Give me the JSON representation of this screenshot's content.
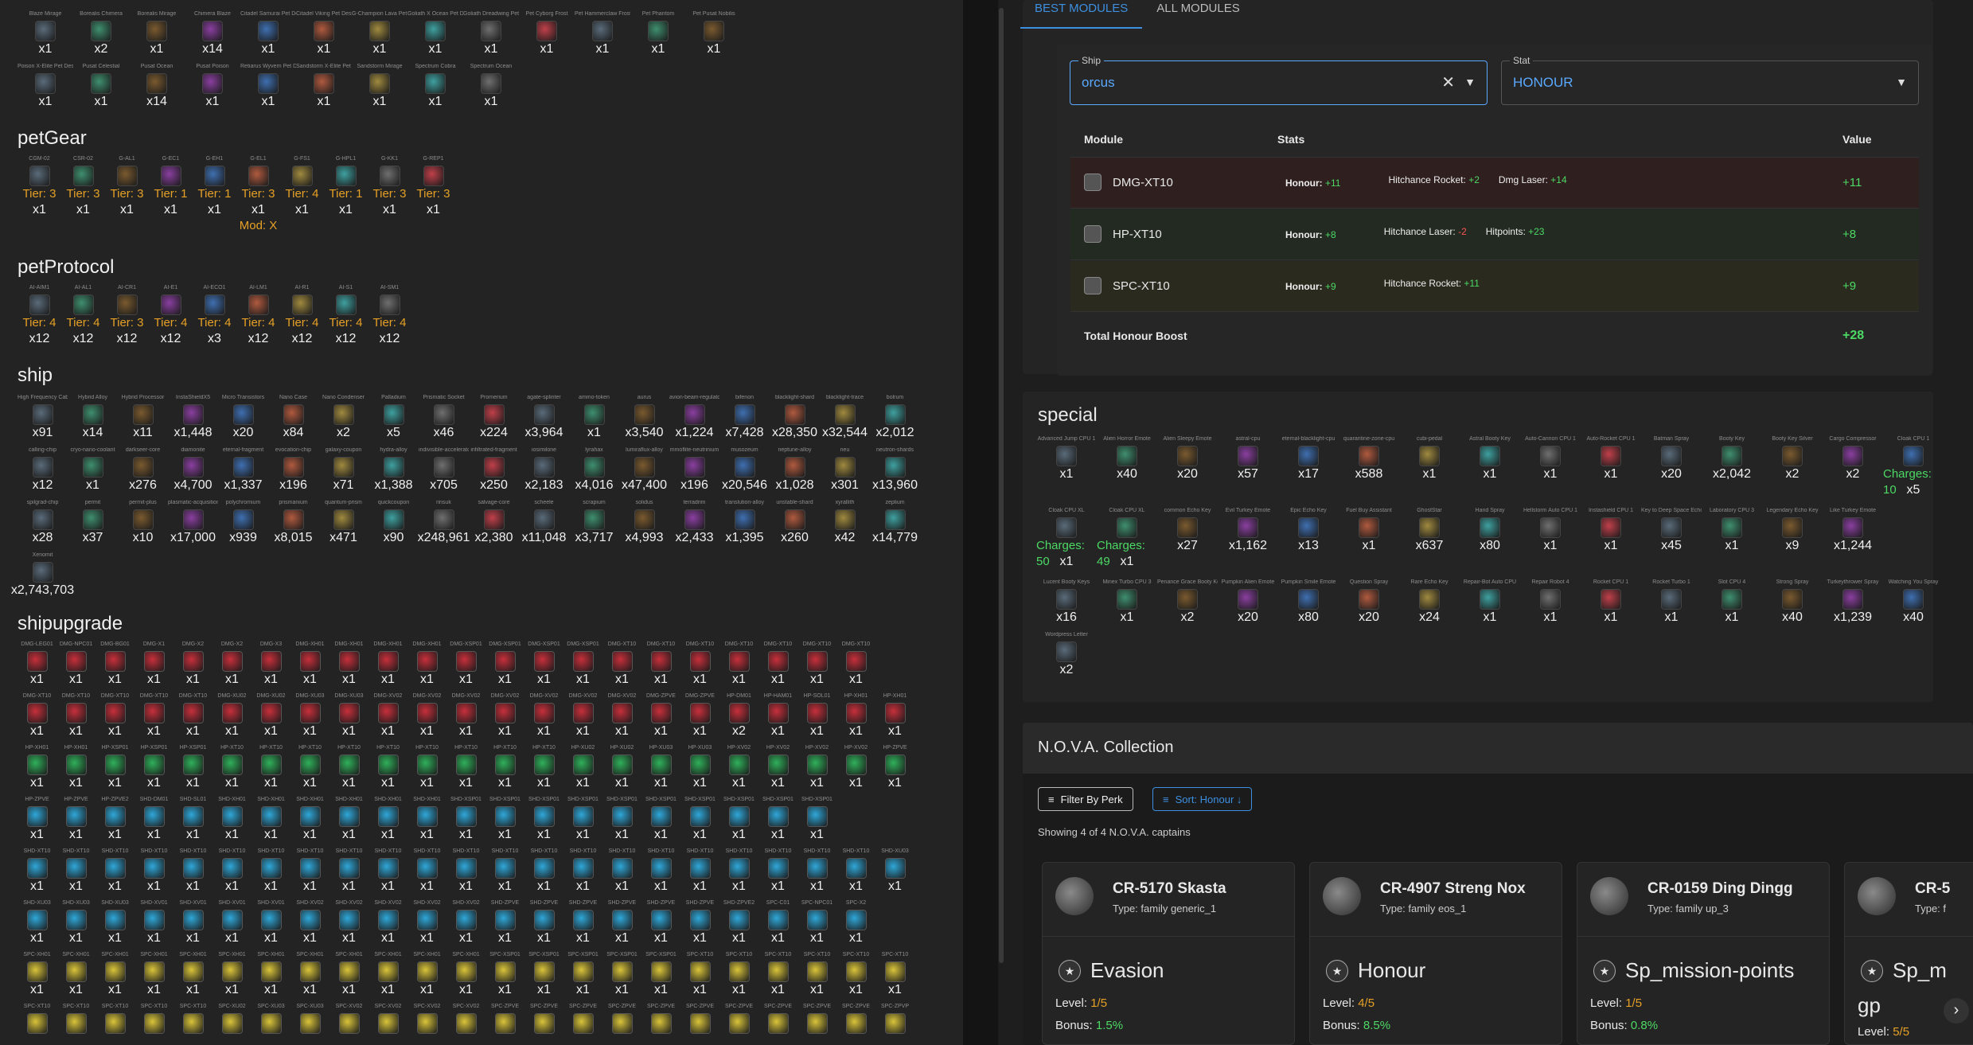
{
  "tabs": {
    "best": "BEST MODULES",
    "all": "ALL MODULES"
  },
  "filter": {
    "ship_label": "Ship",
    "ship_value": "orcus",
    "stat_label": "Stat",
    "stat_value": "HONOUR"
  },
  "table": {
    "h_module": "Module",
    "h_stats": "Stats",
    "h_value": "Value",
    "rows": [
      {
        "module": "DMG-XT10",
        "main": "Honour:",
        "main_v": "+11",
        "s1": "Hitchance Rocket:",
        "s1v": "+2",
        "s2": "Dmg Laser:",
        "s2v": "+14",
        "value": "+11",
        "color": "#2f1f1f"
      },
      {
        "module": "HP-XT10",
        "main": "Honour:",
        "main_v": "+8",
        "s1": "Hitchance Laser:",
        "s1v": "-2",
        "s2": "Hitpoints:",
        "s2v": "+23",
        "value": "+8",
        "color": "#222a22"
      },
      {
        "module": "SPC-XT10",
        "main": "Honour:",
        "main_v": "+9",
        "s1": "Hitchance Rocket:",
        "s1v": "+11",
        "s2": "",
        "s2v": "",
        "value": "+9",
        "color": "#2b2a1f"
      }
    ],
    "total_label": "Total Honour Boost",
    "total_value": "+28"
  },
  "sections": {
    "petgear": "petGear",
    "petprotocol": "petProtocol",
    "ship": "ship",
    "shipupgrade": "shipupgrade",
    "special": "special"
  },
  "pet_top1": [
    [
      "Blaze Mirage",
      "x1"
    ],
    [
      "Borealis Chimera",
      "x2"
    ],
    [
      "Borealis Mirage",
      "x1"
    ],
    [
      "Chimera Blaze",
      "x14"
    ],
    [
      "Citadel Samurai Pet Design",
      "x1"
    ],
    [
      "Citadel Viking Pet Design",
      "x1"
    ],
    [
      "G-Champion Lava Pet Design",
      "x1"
    ],
    [
      "Goliath X Ocean Pet Design",
      "x1"
    ],
    [
      "Goliath Dreadwing Pet Design",
      "x1"
    ],
    [
      "Pet Cyborg Frost",
      "x1"
    ],
    [
      "Pet Hammerclaw Frost",
      "x1"
    ],
    [
      "Pet Phantom",
      "x1"
    ],
    [
      "Pet Pusat Nobilis",
      "x1"
    ]
  ],
  "pet_top2": [
    [
      "Poison X-Elite Pet Design",
      "x1"
    ],
    [
      "Pusat Celestial",
      "x1"
    ],
    [
      "Pusat Ocean",
      "x14"
    ],
    [
      "Pusat Poison",
      "x1"
    ],
    [
      "Retiarus Wyvern Pet Design",
      "x1"
    ],
    [
      "Sandstorm X-Elite Pet Design",
      "x1"
    ],
    [
      "Sandstorm Mirage",
      "x1"
    ],
    [
      "Spectrum Cobra",
      "x1"
    ],
    [
      "Spectrum Ocean",
      "x1"
    ]
  ],
  "petgear": [
    [
      "CGM-02",
      "Tier: 3",
      "x1"
    ],
    [
      "CSR-02",
      "Tier: 3",
      "x1"
    ],
    [
      "G-AL1",
      "Tier: 3",
      "x1"
    ],
    [
      "G-EC1",
      "Tier: 1",
      "x1"
    ],
    [
      "G-EH1",
      "Tier: 1",
      "x1"
    ],
    [
      "G-EL1",
      "Tier: 3",
      "x1",
      "Mod: X"
    ],
    [
      "G-FS1",
      "Tier: 4",
      "x1"
    ],
    [
      "G-HPL1",
      "Tier: 1",
      "x1"
    ],
    [
      "G-KK1",
      "Tier: 3",
      "x1"
    ],
    [
      "G-REP1",
      "Tier: 3",
      "x1"
    ]
  ],
  "petprotocol": [
    [
      "AI-AIM1",
      "Tier: 4",
      "x12"
    ],
    [
      "AI-AL1",
      "Tier: 4",
      "x12"
    ],
    [
      "AI-CR1",
      "Tier: 3",
      "x12"
    ],
    [
      "AI-E1",
      "Tier: 4",
      "x12"
    ],
    [
      "AI-ECO1",
      "Tier: 4",
      "x3"
    ],
    [
      "AI-LM1",
      "Tier: 4",
      "x12"
    ],
    [
      "AI-R1",
      "Tier: 4",
      "x12"
    ],
    [
      "AI-S1",
      "Tier: 4",
      "x12"
    ],
    [
      "AI-SM1",
      "Tier: 4",
      "x12"
    ]
  ],
  "ship1": [
    [
      "High Frequency Cable",
      "x91"
    ],
    [
      "Hybrid Alloy",
      "x14"
    ],
    [
      "Hybrid Processor",
      "x11"
    ],
    [
      "InstaShieldX5",
      "x1,448"
    ],
    [
      "Micro Transistors",
      "x20"
    ],
    [
      "Nano Case",
      "x84"
    ],
    [
      "Nano Condenser",
      "x2"
    ],
    [
      "Palladium",
      "x5"
    ],
    [
      "Prismatic Socket",
      "x46"
    ],
    [
      "Promerium",
      "x224"
    ],
    [
      "agate-splinter",
      "x3,964"
    ],
    [
      "ammo-token",
      "x1"
    ],
    [
      "aurus",
      "x3,540"
    ],
    [
      "avion-beam-regulator",
      "x1,224"
    ],
    [
      "bifenon",
      "x7,428"
    ],
    [
      "blacklight-shard",
      "x28,350"
    ],
    [
      "blacklight-trace",
      "x32,544"
    ],
    [
      "bolrum",
      "x2,012"
    ]
  ],
  "ship2": [
    [
      "calling-chip",
      "x12"
    ],
    [
      "cryo-nano-coolant",
      "x1"
    ],
    [
      "darkseer-core",
      "x276"
    ],
    [
      "diamonite",
      "x4,700"
    ],
    [
      "eternal-fragment",
      "x1,337"
    ],
    [
      "evocation-chip",
      "x196"
    ],
    [
      "galaxy-coupon",
      "x71"
    ],
    [
      "hydra-alloy",
      "x1,388"
    ],
    [
      "indivisible-accelerator",
      "x705"
    ],
    [
      "infiltrated-fragment",
      "x250"
    ],
    [
      "iosimilone",
      "x2,183"
    ],
    [
      "lyrahax",
      "x4,016"
    ],
    [
      "lumiraflux-alloy",
      "x47,400"
    ],
    [
      "mmoflite-neutrinium",
      "x196"
    ],
    [
      "musozeum",
      "x20,546"
    ],
    [
      "neptune-alloy",
      "x1,028"
    ],
    [
      "neu",
      "x301"
    ],
    [
      "neutron-shards",
      "x13,960"
    ]
  ],
  "ship3": [
    [
      "spilgrad-chip",
      "x28"
    ],
    [
      "permit",
      "x37"
    ],
    [
      "permit-plus",
      "x10"
    ],
    [
      "plasmatic-acquisition-plate",
      "x17,000"
    ],
    [
      "polychromium",
      "x939"
    ],
    [
      "prismanium",
      "x8,015"
    ],
    [
      "quantum-prism",
      "x471"
    ],
    [
      "quickcoupon",
      "x90"
    ],
    [
      "rinsuk",
      "x248,961"
    ],
    [
      "salvage-core",
      "x2,380"
    ],
    [
      "scheele",
      "x11,048"
    ],
    [
      "scrapium",
      "x3,717"
    ],
    [
      "solidus",
      "x4,993"
    ],
    [
      "terradrim",
      "x2,433"
    ],
    [
      "translution-alloy",
      "x1,395"
    ],
    [
      "unstable-shard",
      "x260"
    ],
    [
      "xyrallith",
      "x42"
    ],
    [
      "zeplium",
      "x14,779"
    ]
  ],
  "ship4": [
    [
      "Xenomit",
      "x2,743,703"
    ]
  ],
  "special1": [
    [
      "Advanced Jump CPU 1",
      "x1"
    ],
    [
      "Alien Horror Emote",
      "x40"
    ],
    [
      "Alien Sleepy Emote",
      "x20"
    ],
    [
      "astral-cpu",
      "x57"
    ],
    [
      "eternal-blacklight-cpu",
      "x17"
    ],
    [
      "quarantine-zone-cpu",
      "x588"
    ],
    [
      "cubi-pedal",
      "x1"
    ],
    [
      "Astral Booty Key",
      "x1"
    ],
    [
      "Auto-Cannon CPU 1",
      "x1"
    ],
    [
      "Auto-Rocket CPU 1",
      "x1"
    ],
    [
      "Batman Spray",
      "x20"
    ],
    [
      "Booty Key",
      "x2,042"
    ],
    [
      "Booty Key Silver",
      "x2"
    ],
    [
      "Cargo Compressor",
      "x2"
    ],
    [
      "Cloak CPU 1",
      "Charges: 10",
      "x5"
    ]
  ],
  "special2": [
    [
      "Cloak CPU XL",
      "Charges: 50",
      "x1"
    ],
    [
      "Cloak CPU XL",
      "Charges: 49",
      "x1"
    ],
    [
      "common Echo Key",
      "x27"
    ],
    [
      "Evil Turkey Emote",
      "x1,162"
    ],
    [
      "Epic Echo Key",
      "x13"
    ],
    [
      "Fuel Buy Assistant",
      "x1"
    ],
    [
      "GhostStar",
      "x637"
    ],
    [
      "Hand Spray",
      "x80"
    ],
    [
      "Hellstorm Auto CPU 1",
      "x1"
    ],
    [
      "Instashield CPU 1",
      "x1"
    ],
    [
      "Key to Deep Space Echoes",
      "x45"
    ],
    [
      "Laboratory CPU 3",
      "x1"
    ],
    [
      "Legendary Echo Key",
      "x9"
    ],
    [
      "Like Turkey Emote",
      "x1,244"
    ]
  ],
  "special3": [
    [
      "Lucent Booty Keys",
      "x16"
    ],
    [
      "Minex Turbo CPU 3",
      "x1"
    ],
    [
      "Penance Grace Booty Keys",
      "x2"
    ],
    [
      "Pumpkin Alien Emote",
      "x20"
    ],
    [
      "Pumpkin Smile Emote",
      "x80"
    ],
    [
      "Question Spray",
      "x20"
    ],
    [
      "Rare Echo Key",
      "x24"
    ],
    [
      "Repair-Bot Auto CPU",
      "x1"
    ],
    [
      "Repair Robot 4",
      "x1"
    ],
    [
      "Rocket CPU 1",
      "x1"
    ],
    [
      "Rocket Turbo 1",
      "x1"
    ],
    [
      "Slot CPU 4",
      "x1"
    ],
    [
      "Strong Spray",
      "x40"
    ],
    [
      "Turkeythrower Spray",
      "x1,239"
    ],
    [
      "Watching You Spray",
      "x40"
    ]
  ],
  "special4": [
    [
      "Wordpress Letter",
      "x2"
    ]
  ],
  "shipupgrade_rows": [
    {
      "names": [
        "DMG-LEG01",
        "DMG-NPC01",
        "DMG-BG01",
        "DMG-X1",
        "DMG-X2",
        "DMG-X2",
        "DMG-X3",
        "DMG-XH01",
        "DMG-XH01",
        "DMG-XH01",
        "DMG-XH01",
        "DMG-XSP01",
        "DMG-XSP01",
        "DMG-XSP01",
        "DMG-XSP01",
        "DMG-XT10",
        "DMG-XT10",
        "DMG-XT10",
        "DMG-XT10",
        "DMG-XT10",
        "DMG-XT10",
        "DMG-XT10"
      ],
      "counts": [
        "x1",
        "x1",
        "x1",
        "x1",
        "x1",
        "x1",
        "x1",
        "x1",
        "x1",
        "x1",
        "x1",
        "x1",
        "x1",
        "x1",
        "x1",
        "x1",
        "x1",
        "x1",
        "x1",
        "x1",
        "x1",
        "x1"
      ],
      "color": "#c62f3b"
    },
    {
      "names": [
        "DMG-XT10",
        "DMG-XT10",
        "DMG-XT10",
        "DMG-XT10",
        "DMG-XT10",
        "DMG-XU02",
        "DMG-XU02",
        "DMG-XU03",
        "DMG-XU03",
        "DMG-XV02",
        "DMG-XV02",
        "DMG-XV02",
        "DMG-XV02",
        "DMG-XV02",
        "DMG-XV02",
        "DMG-XV02",
        "DMG-ZPVE",
        "DMG-ZPVE",
        "HP-DM01",
        "HP-HAM01",
        "HP-SOL01",
        "HP-XH01",
        "HP-XH01"
      ],
      "counts": [
        "x1",
        "x1",
        "x1",
        "x1",
        "x1",
        "x1",
        "x1",
        "x1",
        "x1",
        "x1",
        "x1",
        "x1",
        "x1",
        "x1",
        "x1",
        "x1",
        "x1",
        "x1",
        "x2",
        "x1",
        "x1",
        "x1",
        "x1"
      ],
      "color": "#c62f3b"
    },
    {
      "names": [
        "HP-XH01",
        "HP-XH01",
        "HP-XSP01",
        "HP-XSP01",
        "HP-XSP01",
        "HP-XT10",
        "HP-XT10",
        "HP-XT10",
        "HP-XT10",
        "HP-XT10",
        "HP-XT10",
        "HP-XT10",
        "HP-XT10",
        "HP-XT10",
        "HP-XU02",
        "HP-XU02",
        "HP-XU03",
        "HP-XU03",
        "HP-XV02",
        "HP-XV02",
        "HP-XV02",
        "HP-XV02",
        "HP-ZPVE"
      ],
      "counts": [
        "x1",
        "x1",
        "x1",
        "x1",
        "x1",
        "x1",
        "x1",
        "x1",
        "x1",
        "x1",
        "x1",
        "x1",
        "x1",
        "x1",
        "x1",
        "x1",
        "x1",
        "x1",
        "x1",
        "x1",
        "x1",
        "x1",
        "x1"
      ],
      "color": "#2fb05a"
    },
    {
      "names": [
        "HP-ZPVE",
        "HP-ZPVE",
        "HP-ZPVE2",
        "SHD-DM01",
        "SHD-SL01",
        "SHD-XH01",
        "SHD-XH01",
        "SHD-XH01",
        "SHD-XH01",
        "SHD-XH01",
        "SHD-XH01",
        "SHD-XSP01",
        "SHD-XSP01",
        "SHD-XSP01",
        "SHD-XSP01",
        "SHD-XSP01",
        "SHD-XSP01",
        "SHD-XSP01",
        "SHD-XSP01",
        "SHD-XSP01",
        "SHD-XSP01"
      ],
      "counts": [
        "x1",
        "x1",
        "x1",
        "x1",
        "x1",
        "x1",
        "x1",
        "x1",
        "x1",
        "x1",
        "x1",
        "x1",
        "x1",
        "x1",
        "x1",
        "x1",
        "x1",
        "x1",
        "x1",
        "x1",
        "x1"
      ],
      "color": "#2fa7d8"
    },
    {
      "names": [
        "SHD-XT10",
        "SHD-XT10",
        "SHD-XT10",
        "SHD-XT10",
        "SHD-XT10",
        "SHD-XT10",
        "SHD-XT10",
        "SHD-XT10",
        "SHD-XT10",
        "SHD-XT10",
        "SHD-XT10",
        "SHD-XT10",
        "SHD-XT10",
        "SHD-XT10",
        "SHD-XT10",
        "SHD-XT10",
        "SHD-XT10",
        "SHD-XT10",
        "SHD-XT10",
        "SHD-XT10",
        "SHD-XT10",
        "SHD-XT10",
        "SHD-XU03"
      ],
      "counts": [
        "x1",
        "x1",
        "x1",
        "x1",
        "x1",
        "x1",
        "x1",
        "x1",
        "x1",
        "x1",
        "x1",
        "x1",
        "x1",
        "x1",
        "x1",
        "x1",
        "x1",
        "x1",
        "x1",
        "x1",
        "x1",
        "x1",
        "x1"
      ],
      "color": "#2fa7d8"
    },
    {
      "names": [
        "SHD-XU03",
        "SHD-XU03",
        "SHD-XU03",
        "SHD-XV01",
        "SHD-XV01",
        "SHD-XV01",
        "SHD-XV01",
        "SHD-XV02",
        "SHD-XV02",
        "SHD-XV02",
        "SHD-XV02",
        "SHD-XV02",
        "SHD-ZPVE",
        "SHD-ZPVE",
        "SHD-ZPVE",
        "SHD-ZPVE",
        "SHD-ZPVE",
        "SHD-ZPVE",
        "SHD-ZPVE2",
        "SPC-C01",
        "SPC-NPC01",
        "SPC-X2"
      ],
      "counts": [
        "x1",
        "x1",
        "x1",
        "x1",
        "x1",
        "x1",
        "x1",
        "x1",
        "x1",
        "x1",
        "x1",
        "x1",
        "x1",
        "x1",
        "x1",
        "x1",
        "x1",
        "x1",
        "x1",
        "x1",
        "x1",
        "x1"
      ],
      "color": "#2fa7d8"
    },
    {
      "names": [
        "SPC-XH01",
        "SPC-XH01",
        "SPC-XH01",
        "SPC-XH01",
        "SPC-XH01",
        "SPC-XH01",
        "SPC-XH01",
        "SPC-XH01",
        "SPC-XH01",
        "SPC-XH01",
        "SPC-XH01",
        "SPC-XH01",
        "SPC-XSP01",
        "SPC-XSP01",
        "SPC-XSP01",
        "SPC-XSP01",
        "SPC-XSP01",
        "SPC-XT10",
        "SPC-XT10",
        "SPC-XT10",
        "SPC-XT10",
        "SPC-XT10",
        "SPC-XT10"
      ],
      "counts": [
        "x1",
        "x1",
        "x1",
        "x1",
        "x1",
        "x1",
        "x1",
        "x1",
        "x1",
        "x1",
        "x1",
        "x1",
        "x1",
        "x1",
        "x1",
        "x1",
        "x1",
        "x1",
        "x1",
        "x1",
        "x1",
        "x1",
        "x1"
      ],
      "color": "#d9c43a"
    },
    {
      "names": [
        "SPC-XT10",
        "SPC-XT10",
        "SPC-XT10",
        "SPC-XT10",
        "SPC-XT10",
        "SPC-XU02",
        "SPC-XU03",
        "SPC-XU03",
        "SPC-XV02",
        "SPC-XV02",
        "SPC-XV02",
        "SPC-XV02",
        "SPC-ZPVE",
        "SPC-ZPVE",
        "SPC-ZPVE",
        "SPC-ZPVE",
        "SPC-ZPVE",
        "SPC-ZPVE",
        "SPC-ZPVE",
        "SPC-ZPVE",
        "SPC-ZPVE",
        "SPC-ZPVE",
        "SPC-ZPVP"
      ],
      "counts": [
        "",
        "",
        "",
        "",
        "",
        "",
        "",
        "",
        "",
        "",
        "",
        "",
        "",
        "",
        "",
        "",
        "",
        "",
        "",
        "",
        "",
        "",
        ""
      ],
      "color": "#d9c43a"
    }
  ],
  "nova": {
    "title": "N.O.V.A. Collection",
    "filter_btn": "Filter By Perk",
    "sort_btn": "Sort: Honour ↓",
    "showing": "Showing 4 of 4 N.O.V.A. captains",
    "cards": [
      {
        "name": "CR-5170 Skasta",
        "type": "Type: family generic_1",
        "perk": "Evasion",
        "level_l": "Level:",
        "level": "1/5",
        "bonus_l": "Bonus:",
        "bonus": "1.5%"
      },
      {
        "name": "CR-4907 Streng Nox",
        "type": "Type: family eos_1",
        "perk": "Honour",
        "level_l": "Level:",
        "level": "4/5",
        "bonus_l": "Bonus:",
        "bonus": "8.5%"
      },
      {
        "name": "CR-0159 Ding Dingg",
        "type": "Type: family up_3",
        "perk": "Sp_mission-points",
        "level_l": "Level:",
        "level": "1/5",
        "bonus_l": "Bonus:",
        "bonus": "0.8%"
      },
      {
        "name": "CR-5",
        "type": "Type: f",
        "perk": "Sp_m",
        "perk2": "gp",
        "level_l": "Level:",
        "level": "5/5",
        "bonus_l": "",
        "bonus": ""
      }
    ]
  }
}
